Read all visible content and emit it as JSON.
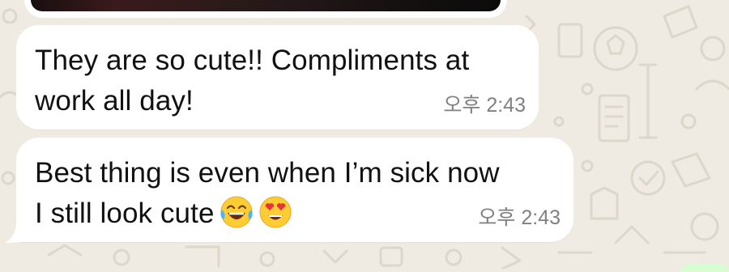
{
  "chat": {
    "wallpaper_icon": "doodle-pattern-icon",
    "messages": [
      {
        "line1": "They are so cute!! Compliments at",
        "line2": "work all day!",
        "time": "오후 2:43"
      },
      {
        "line1": "Best thing is even when I’m sick now",
        "line2": "I still look cute",
        "emojis": [
          "face-with-tears-of-joy-icon",
          "smiling-face-with-heart-eyes-icon"
        ],
        "time": "오후 2:43"
      }
    ]
  },
  "colors": {
    "background": "#efeae2",
    "incoming_bubble": "#ffffff",
    "outgoing_bubble": "#d9fdd3",
    "timestamp": "#808080",
    "text": "#111111"
  }
}
